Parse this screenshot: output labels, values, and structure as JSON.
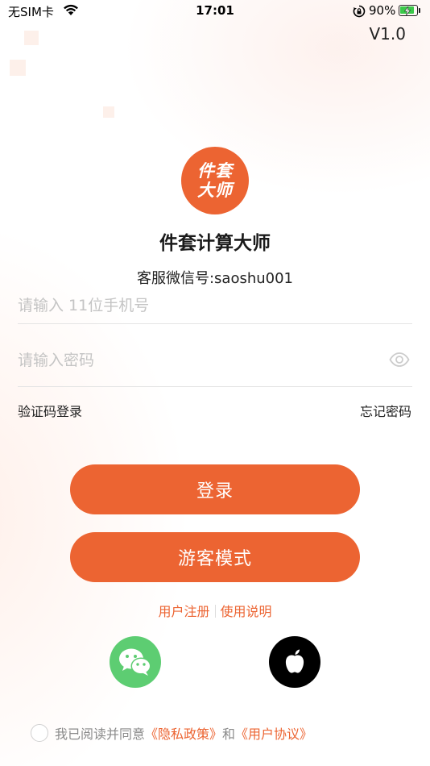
{
  "status_bar": {
    "carrier": "无SIM卡",
    "time": "17:01",
    "battery_percent": "90%",
    "battery_level": 0.9
  },
  "version": "V1.0",
  "logo": {
    "line1": "件套",
    "line2": "大师"
  },
  "app_name": "件套计算大师",
  "service_text": "客服微信号:saoshu001",
  "phone_input": {
    "placeholder": "请输入 11位手机号",
    "value": ""
  },
  "password_input": {
    "placeholder": "请输入密码",
    "value": ""
  },
  "links": {
    "sms_login": "验证码登录",
    "forgot_password": "忘记密码"
  },
  "buttons": {
    "login": "登录",
    "guest": "游客模式"
  },
  "register_row": {
    "register": "用户注册",
    "instructions": "使用说明"
  },
  "agreement": {
    "prefix": "我已阅读并同意",
    "privacy": "《隐私政策》",
    "and": "和",
    "user_agreement": "《用户协议》"
  },
  "colors": {
    "accent": "#ec6432",
    "wechat": "#5dcd72",
    "apple": "#000000"
  },
  "icons": [
    "wifi-icon",
    "rotation-lock-icon",
    "battery-icon",
    "eye-icon",
    "wechat-icon",
    "apple-icon"
  ]
}
